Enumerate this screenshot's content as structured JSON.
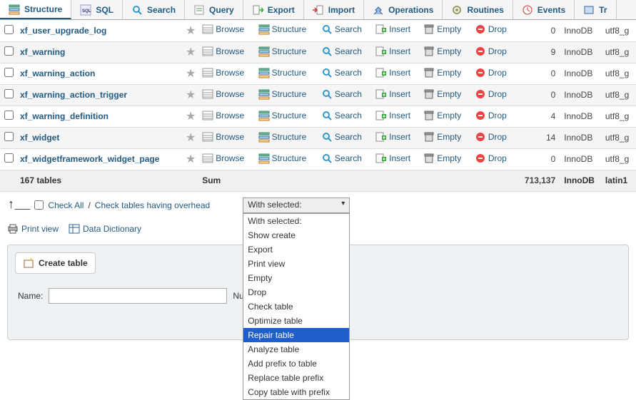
{
  "tabs": [
    {
      "label": "Structure",
      "icon": "structure"
    },
    {
      "label": "SQL",
      "icon": "sql"
    },
    {
      "label": "Search",
      "icon": "search"
    },
    {
      "label": "Query",
      "icon": "query"
    },
    {
      "label": "Export",
      "icon": "export"
    },
    {
      "label": "Import",
      "icon": "import"
    },
    {
      "label": "Operations",
      "icon": "operations"
    },
    {
      "label": "Routines",
      "icon": "routines"
    },
    {
      "label": "Events",
      "icon": "events"
    },
    {
      "label": "Tr",
      "icon": "triggers"
    }
  ],
  "actions": {
    "browse": "Browse",
    "structure": "Structure",
    "search": "Search",
    "insert": "Insert",
    "empty": "Empty",
    "drop": "Drop"
  },
  "rows": [
    {
      "name": "xf_user_upgrade_log",
      "rows": "0",
      "engine": "InnoDB",
      "collation": "utf8_g"
    },
    {
      "name": "xf_warning",
      "rows": "9",
      "engine": "InnoDB",
      "collation": "utf8_g"
    },
    {
      "name": "xf_warning_action",
      "rows": "0",
      "engine": "InnoDB",
      "collation": "utf8_g"
    },
    {
      "name": "xf_warning_action_trigger",
      "rows": "0",
      "engine": "InnoDB",
      "collation": "utf8_g"
    },
    {
      "name": "xf_warning_definition",
      "rows": "4",
      "engine": "InnoDB",
      "collation": "utf8_g"
    },
    {
      "name": "xf_widget",
      "rows": "14",
      "engine": "InnoDB",
      "collation": "utf8_g"
    },
    {
      "name": "xf_widgetframework_widget_page",
      "rows": "0",
      "engine": "InnoDB",
      "collation": "utf8_g"
    }
  ],
  "summary": {
    "count_label": "167 tables",
    "sum_label": "Sum",
    "total_rows": "713,137",
    "engine": "InnoDB",
    "collation": "latin1"
  },
  "checkall": {
    "checkall": "Check All",
    "sep": " / ",
    "overhead": "Check tables having overhead"
  },
  "dropdown": {
    "selected": "With selected:",
    "options": [
      "With selected:",
      "Show create",
      "Export",
      "Print view",
      "Empty",
      "Drop",
      "Check table",
      "Optimize table",
      "Repair table",
      "Analyze table",
      "Add prefix to table",
      "Replace table prefix",
      "Copy table with prefix"
    ],
    "highlighted_index": 8
  },
  "printview": "Print view",
  "datadict": "Data Dictionary",
  "create": {
    "title": "Create table",
    "name_label": "Name:",
    "num_label": "Num"
  }
}
